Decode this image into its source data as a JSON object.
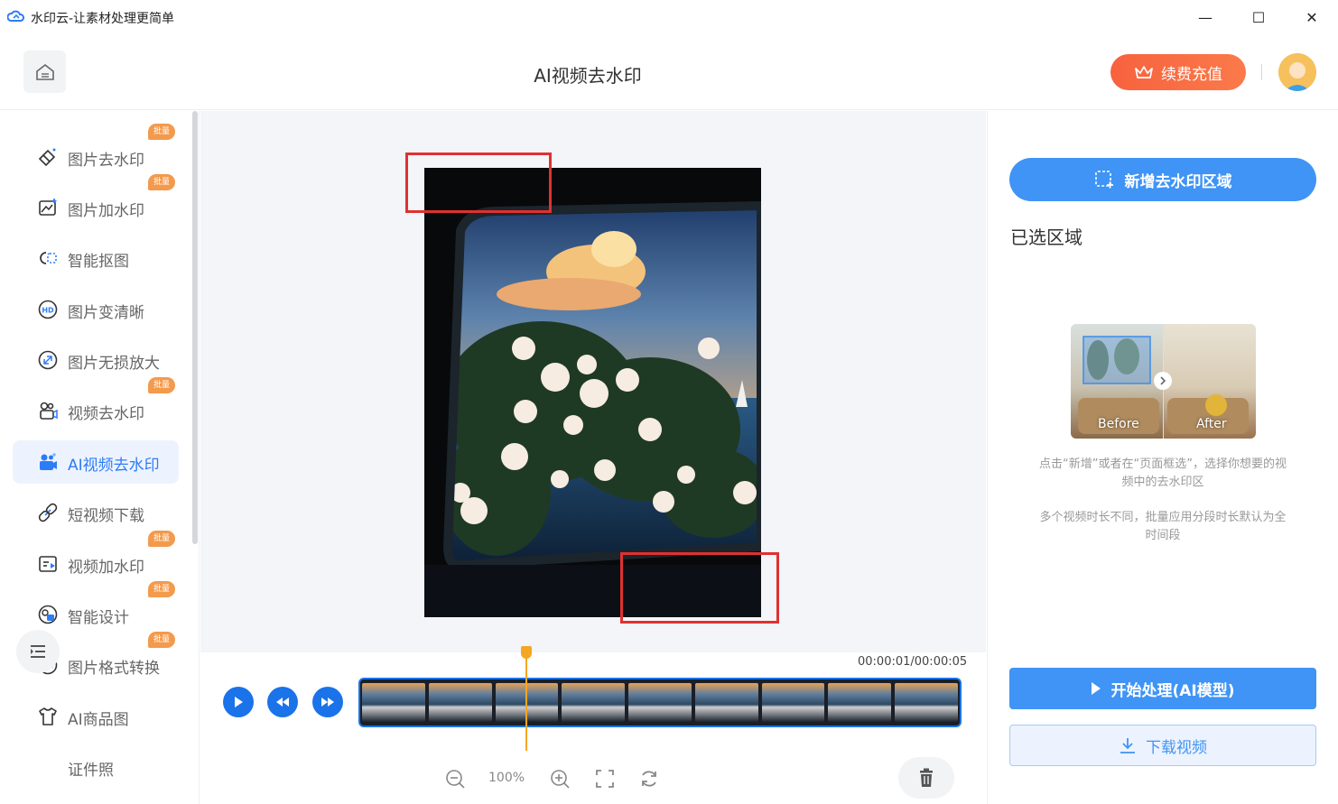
{
  "window": {
    "title": "水印云-让素材处理更简单",
    "minimize_glyph": "—",
    "maximize_glyph": "☐",
    "close_glyph": "✕"
  },
  "header": {
    "title": "AI视频去水印",
    "recharge_label": "续费充值"
  },
  "sidebar": {
    "badge_text": "批量",
    "items": [
      {
        "label": "图片去水印",
        "icon": "eraser-icon",
        "badge": true
      },
      {
        "label": "图片加水印",
        "icon": "image-add-icon",
        "badge": true
      },
      {
        "label": "智能抠图",
        "icon": "cutout-icon",
        "badge": false
      },
      {
        "label": "图片变清晰",
        "icon": "hd-icon",
        "badge": false
      },
      {
        "label": "图片无损放大",
        "icon": "enlarge-icon",
        "badge": false
      },
      {
        "label": "视频去水印",
        "icon": "video-watermark-icon",
        "badge": true
      },
      {
        "label": "AI视频去水印",
        "icon": "ai-video-icon",
        "badge": false,
        "active": true
      },
      {
        "label": "短视频下载",
        "icon": "link-download-icon",
        "badge": false
      },
      {
        "label": "视频加水印",
        "icon": "video-add-icon",
        "badge": true
      },
      {
        "label": "智能设计",
        "icon": "design-icon",
        "badge": true
      },
      {
        "label": "图片格式转换",
        "icon": "format-convert-icon",
        "badge": true
      },
      {
        "label": "AI商品图",
        "icon": "shirt-icon",
        "badge": false
      },
      {
        "label": "证件照",
        "icon": "id-photo-icon",
        "badge": false
      }
    ]
  },
  "timeline": {
    "time": "00:00:01/00:00:05",
    "zoom": "100%",
    "progress_fraction": 0.2
  },
  "right_panel": {
    "add_region_label": "新增去水印区域",
    "selected_title": "已选区域",
    "demo_before": "Before",
    "demo_after": "After",
    "hint1": "点击“新增”或者在“页面框选”，选择你想要的视频中的去水印区",
    "hint2": "多个视频时长不同，批量应用分段时长默认为全时间段",
    "start_label": "开始处理(AI模型)",
    "download_label": "下载视频"
  },
  "colors": {
    "accent": "#3f94f5",
    "recharge": "#f7623e",
    "selection": "#e03131",
    "playhead": "#f5a623",
    "badge": "#f39a4d"
  }
}
